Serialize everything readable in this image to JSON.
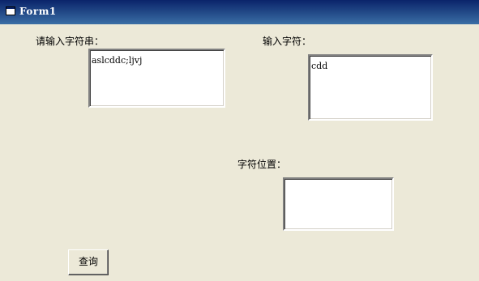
{
  "window": {
    "title": "Form1",
    "title_color": "#0A246A",
    "bg_color": "#ECE9D8"
  },
  "labels": {
    "input_string": "请输入字符串：",
    "input_char": "输入字符：",
    "char_position": "字符位置："
  },
  "fields": {
    "string_value": "aslcddc;ljvj",
    "char_value": "cdd",
    "position_value": ""
  },
  "buttons": {
    "query": "查询"
  }
}
